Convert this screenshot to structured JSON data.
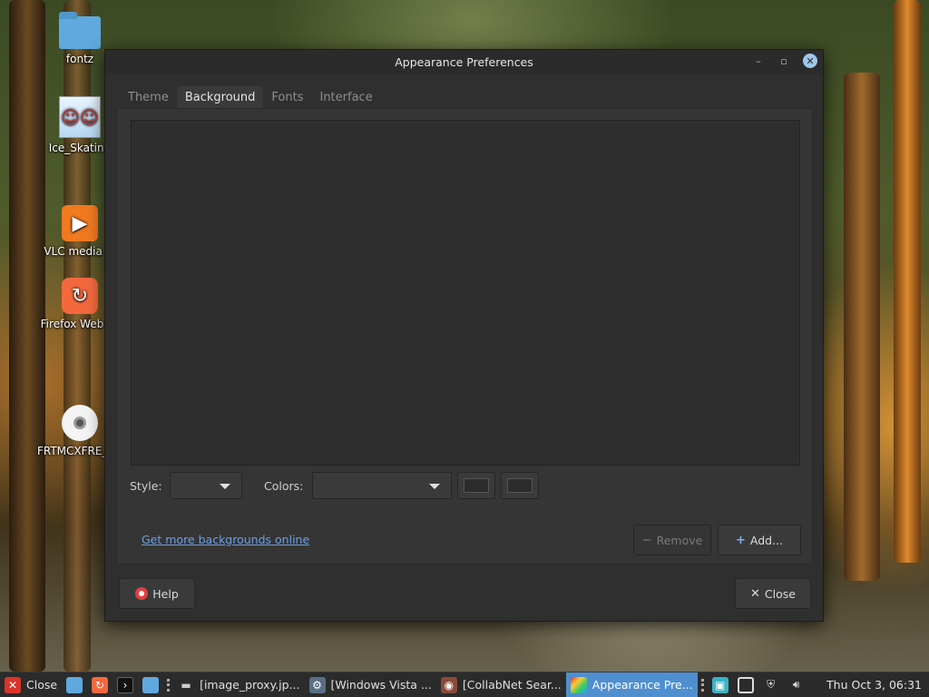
{
  "desktop": {
    "icons": [
      {
        "label": "fontz",
        "icon": "folder-icon"
      },
      {
        "label": "Ice_Skating",
        "icon": "image-file-icon"
      },
      {
        "label": "VLC media pl",
        "icon": "vlc-icon"
      },
      {
        "label": "Firefox Web Br",
        "icon": "firefox-icon"
      },
      {
        "label": "FRTMCXFRE_EN",
        "icon": "disc-icon"
      }
    ]
  },
  "dialog": {
    "title": "Appearance Preferences",
    "tabs": [
      "Theme",
      "Background",
      "Fonts",
      "Interface"
    ],
    "active_tab": "Background",
    "style_label": "Style:",
    "style_value": "",
    "colors_label": "Colors:",
    "colors_value": "",
    "link_text": "Get more backgrounds online",
    "remove_label": "Remove",
    "add_label": "Add...",
    "help_label": "Help",
    "close_label": "Close"
  },
  "taskbar": {
    "close_label": "Close",
    "windows": [
      {
        "label": "[image_proxy.jp...",
        "icon": "minus-icon"
      },
      {
        "label": "[Windows Vista ...",
        "icon": "app-icon"
      },
      {
        "label": "[CollabNet Sear...",
        "icon": "app-icon"
      },
      {
        "label": "Appearance Pre...",
        "icon": "appearance-icon",
        "active": true
      }
    ],
    "clock": "Thu Oct  3, 06:31"
  },
  "colors": {
    "accent": "#4f8fd0",
    "link": "#6d9fe0",
    "dialog_bg": "#2f2f2f"
  }
}
